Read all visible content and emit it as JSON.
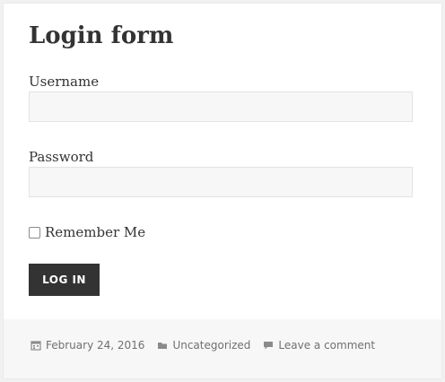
{
  "form": {
    "title": "Login form",
    "username_label": "Username",
    "username_value": "",
    "password_label": "Password",
    "password_value": "",
    "remember_label": "Remember Me",
    "remember_checked": false,
    "submit_label": "LOG IN"
  },
  "footer": {
    "date": "February 24, 2016",
    "category": "Uncategorized",
    "comment_link": "Leave a comment",
    "icons": [
      "calendar-icon",
      "folder-icon",
      "comment-icon"
    ]
  },
  "colors": {
    "page_background": "#f1f1f1",
    "card_background": "#ffffff",
    "field_background": "#f7f7f7",
    "button_background": "#333333",
    "meta_text": "#707070"
  }
}
